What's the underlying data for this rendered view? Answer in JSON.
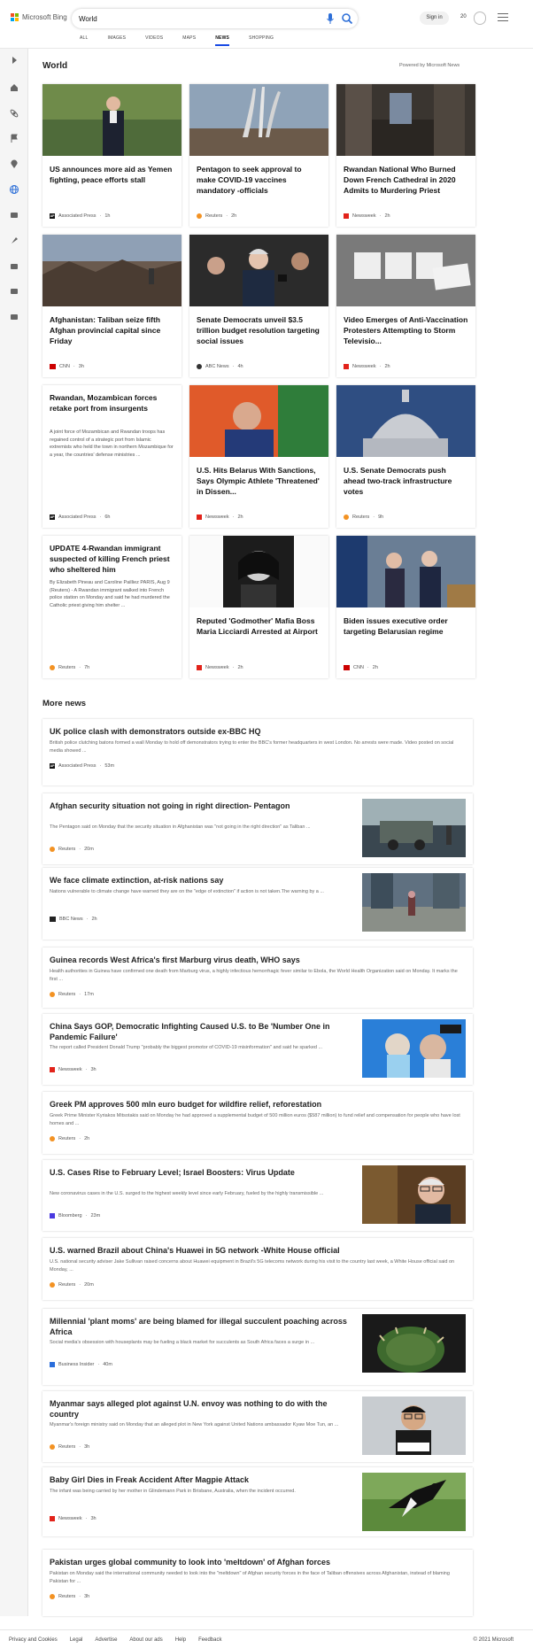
{
  "header": {
    "logo_text": "Microsoft Bing",
    "search_value": "World",
    "signin_label": "Sign in",
    "points": "20"
  },
  "tabs": [
    {
      "label": "ALL"
    },
    {
      "label": "IMAGES"
    },
    {
      "label": "VIDEOS"
    },
    {
      "label": "MAPS"
    },
    {
      "label": "NEWS",
      "active": true
    },
    {
      "label": "SHOPPING"
    }
  ],
  "section": {
    "title": "World",
    "powered_by": "Powered by Microsoft News"
  },
  "cards": [
    {
      "title": "US announces more aid as Yemen fighting, peace efforts stall",
      "source": "Associated Press",
      "age": "1h",
      "logo": "ap",
      "image": "man-suit-outdoors"
    },
    {
      "title": "Pentagon to seek approval to make COVID-19 vaccines mandatory -officials",
      "source": "Reuters",
      "age": "2h",
      "logo": "reuters",
      "image": "air-force-memorial"
    },
    {
      "title": "Rwandan National Who Burned Down French Cathedral in 2020 Admits to Murdering Priest",
      "source": "Newsweek",
      "age": "2h",
      "logo": "newsweek",
      "image": "burned-cathedral"
    },
    {
      "title": "Afghanistan: Taliban seize fifth Afghan provincial capital since Friday",
      "source": "CNN",
      "age": "3h",
      "logo": "cnn",
      "image": "destroyed-market"
    },
    {
      "title": "Senate Democrats unveil $3.5 trillion budget resolution targeting social issues",
      "source": "ABC News",
      "age": "4h",
      "logo": "abc",
      "image": "senator-press"
    },
    {
      "title": "Video Emerges of Anti-Vaccination Protesters Attempting to Storm Televisio...",
      "source": "Newsweek",
      "age": "2h",
      "logo": "newsweek",
      "image": "bbc-sign"
    },
    {
      "title": "Rwandan, Mozambican forces retake port from insurgents",
      "snippet": "A joint force of Mozambican and Rwandan troops has regained control of a strategic port from Islamic extremists who held the town in northern Mozambique for a year, the countries' defense ministries ...",
      "source": "Associated Press",
      "age": "6h",
      "logo": "ap"
    },
    {
      "title": "U.S. Hits Belarus With Sanctions, Says Olympic Athlete 'Threatened' in Dissen...",
      "source": "Newsweek",
      "age": "2h",
      "logo": "newsweek",
      "image": "belarus-leader"
    },
    {
      "title": "U.S. Senate Democrats push ahead two-track infrastructure votes",
      "source": "Reuters",
      "age": "9h",
      "logo": "reuters",
      "image": "capitol-dome"
    },
    {
      "title": "UPDATE 4-Rwandan immigrant suspected of killing French priest who sheltered him",
      "snippet": "By Elizabeth Pineau and Caroline Pailliez PARIS, Aug 9 (Reuters) - A Rwandan immigrant walked into French police station on Monday and said he had murdered the Catholic priest giving him shelter ...",
      "source": "Reuters",
      "age": "7h",
      "logo": "reuters"
    },
    {
      "title": "Reputed 'Godmother' Mafia Boss Maria Licciardi Arrested at Airport",
      "source": "Newsweek",
      "age": "2h",
      "logo": "newsweek",
      "image": "mugshot"
    },
    {
      "title": "Biden issues executive order targeting Belarusian regime",
      "source": "CNN",
      "age": "2h",
      "logo": "cnn",
      "image": "oval-office"
    }
  ],
  "more_news": {
    "title": "More news",
    "items": [
      {
        "title": "UK police clash with demonstrators outside ex-BBC HQ",
        "snippet": "British police clutching batons formed a wall Monday to hold off demonstrators trying to enter the BBC's former headquarters in west London. No arrests were made. Video posted on social media showed ...",
        "source": "Associated Press",
        "age": "53m",
        "logo": "ap"
      },
      {
        "title": "Afghan security situation not going in right direction- Pentagon",
        "snippet": "The Pentagon said on Monday that the security situation in Afghanistan was \"not going in the right direction\" as Taliban ...",
        "source": "Reuters",
        "age": "20m",
        "logo": "reuters",
        "image": "armored-vehicle"
      },
      {
        "title": "We face climate extinction, at-risk nations say",
        "snippet": "Nations vulnerable to climate change have warned they are on the \"edge of extinction\" if action is not taken.The warning by a ...",
        "source": "BBC News",
        "age": "2h",
        "logo": "bbc",
        "image": "flooded-street"
      },
      {
        "title": "Guinea records West Africa's first Marburg virus death, WHO says",
        "snippet": "Health authorities in Guinea have confirmed one death from Marburg virus, a highly infectious hemorrhagic fever similar to Ebola, the World Health Organization said on Monday. It marks the first ...",
        "source": "Reuters",
        "age": "17m",
        "logo": "reuters"
      },
      {
        "title": "China Says GOP, Democratic Infighting Caused U.S. to Be 'Number One in Pandemic Failure'",
        "snippet": "The report called President Donald Trump \"probably the biggest promotor of COVID-19 misinformation\" and said he sparked ...",
        "source": "Newsweek",
        "age": "3h",
        "logo": "newsweek",
        "image": "vaccination"
      },
      {
        "title": "Greek PM approves 500 mln euro budget for wildfire relief, reforestation",
        "snippet": "Greek Prime Minister Kyriakos Mitsotakis said on Monday he had approved a supplemental budget of 500 million euros ($587 million) to fund relief and compensation for people who have lost homes and ...",
        "source": "Reuters",
        "age": "2h",
        "logo": "reuters"
      },
      {
        "title": "U.S. Cases Rise to February Level; Israel Boosters: Virus Update",
        "snippet": "New coronavirus cases in the U.S. surged to the highest weekly level since early February, fueled by the highly transmissible ...",
        "source": "Bloomberg",
        "age": "23m",
        "logo": "bloomberg",
        "image": "man-glasses"
      },
      {
        "title": "U.S. warned Brazil about China's Huawei in 5G network -White House official",
        "snippet": "U.S. national security adviser Jake Sullivan raised concerns about Huawei equipment in Brazil's 5G telecoms network during his visit to the country last week, a White House official said on Monday, ...",
        "source": "Reuters",
        "age": "20m",
        "logo": "reuters"
      },
      {
        "title": "Millennial 'plant moms' are being blamed for illegal succulent poaching across Africa",
        "snippet": "Social media's obsession with houseplants may be fueling a black market for succulents as South Africa faces a surge in ...",
        "source": "Business Insider",
        "age": "40m",
        "logo": "bi",
        "image": "succulent"
      },
      {
        "title": "Myanmar says alleged plot against U.N. envoy was nothing to do with the country",
        "snippet": "Myanmar's foreign ministry said on Monday that an alleged plot in New York against United Nations ambassador Kyaw Moe Tun, an ...",
        "source": "Reuters",
        "age": "3h",
        "logo": "reuters",
        "image": "envoy-portrait"
      },
      {
        "title": "Baby Girl Dies in Freak Accident After Magpie Attack",
        "snippet": "The infant was being carried by her mother in Glindemann Park in Brisbane, Australia, when the incident occurred.",
        "source": "Newsweek",
        "age": "3h",
        "logo": "newsweek",
        "image": "magpie"
      },
      {
        "title": "Pakistan urges global community to look into 'meltdown' of Afghan forces",
        "snippet": "Pakistan on Monday said the international community needed to look into the \"meltdown\" of Afghan security forces in the face of Taliban offensives across Afghanistan, instead of blaming Pakistan for ...",
        "source": "Reuters",
        "age": "3h",
        "logo": "reuters"
      }
    ]
  },
  "footer": {
    "links": [
      "Privacy and Cookies",
      "Legal",
      "Advertise",
      "About our ads",
      "Help",
      "Feedback"
    ],
    "copyright": "© 2021 Microsoft"
  },
  "colors": {
    "accent": "#174ae4",
    "bing_red": "#f25022",
    "bing_green": "#7fba00",
    "bing_blue": "#00a4ef",
    "bing_yellow": "#ffb900"
  }
}
